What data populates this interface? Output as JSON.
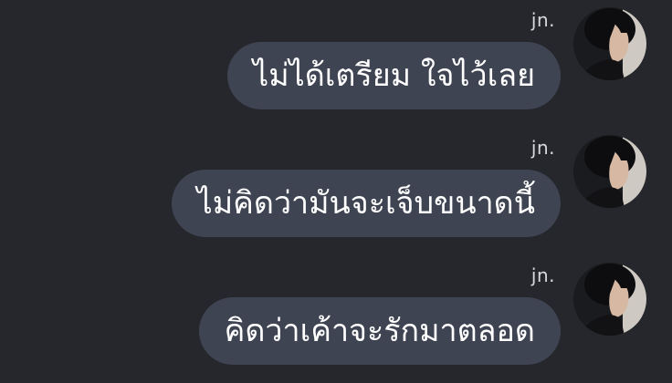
{
  "conversation": {
    "messages": [
      {
        "sender": "jn.",
        "text": "ไม่ได้เตรียม ใจไว้เลย"
      },
      {
        "sender": "jn.",
        "text": "ไม่คิดว่ามันจะเจ็บขนาดนี้"
      },
      {
        "sender": "jn.",
        "text": "คิดว่าเค้าจะรักมาตลอด"
      }
    ]
  },
  "colors": {
    "background": "#25272c",
    "bubble": "#3f4452",
    "text": "#ffffff",
    "sender_text": "#d8d9dc"
  },
  "icons": {
    "avatar": "profile-photo"
  }
}
